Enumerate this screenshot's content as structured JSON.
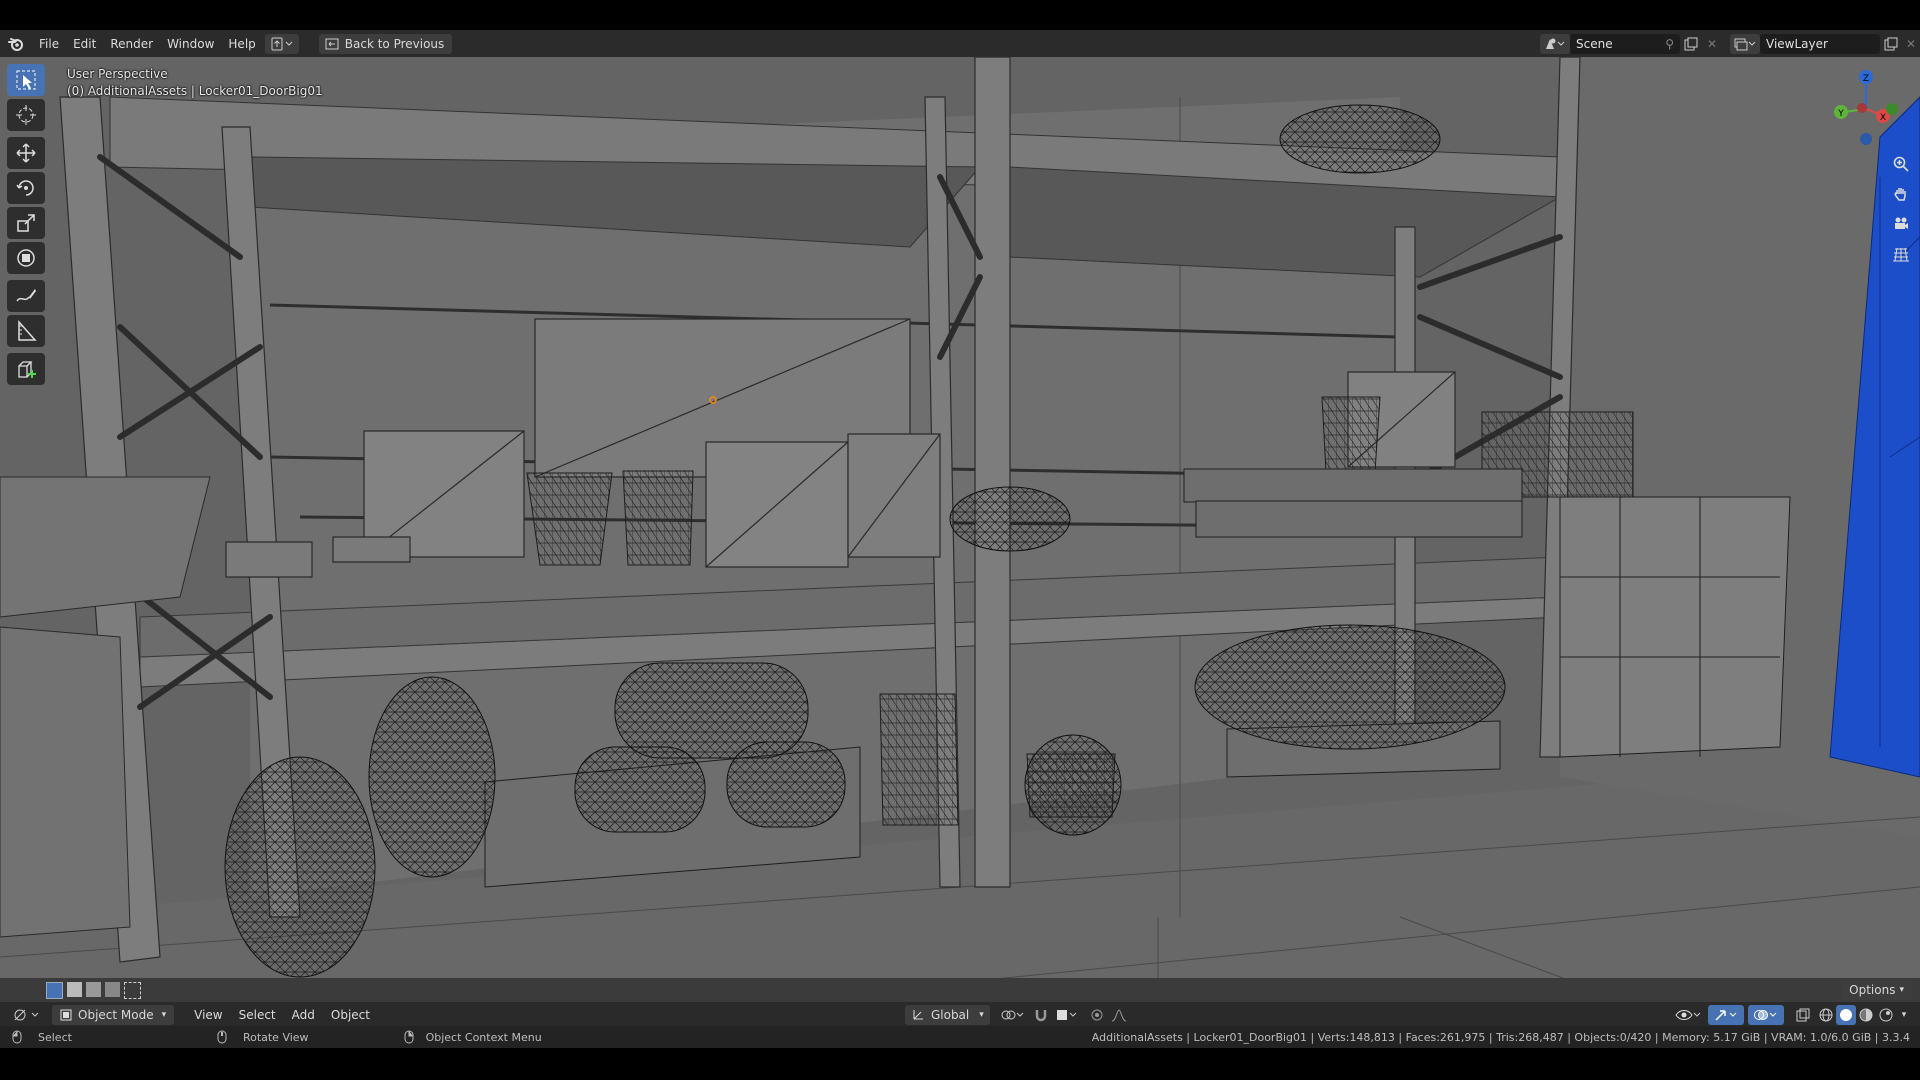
{
  "menubar": {
    "items": [
      "File",
      "Edit",
      "Render",
      "Window",
      "Help"
    ],
    "back_button": "Back to Previous",
    "scene": "Scene",
    "view_layer": "ViewLayer"
  },
  "viewport": {
    "perspective": "User Perspective",
    "object_info": "(0) AdditionalAssets | Locker01_DoorBig01"
  },
  "gizmo": {
    "x": "X",
    "y": "Y",
    "z": "Z"
  },
  "header": {
    "mode": "Object Mode",
    "menus": [
      "View",
      "Select",
      "Add",
      "Object"
    ],
    "transform_orientation": "Global",
    "options": "Options"
  },
  "statusbar": {
    "select": "Select",
    "rotate": "Rotate View",
    "context": "Object Context Menu",
    "stats": "AdditionalAssets | Locker01_DoorBig01 | Verts:148,813 | Faces:261,975 | Tris:268,487 | Objects:0/420 | Memory: 5.17 GiB | VRAM: 1.0/6.0 GiB | 3.3.4"
  },
  "colors": {
    "accent": "#4772b3",
    "selected": "#1d4ec9"
  }
}
